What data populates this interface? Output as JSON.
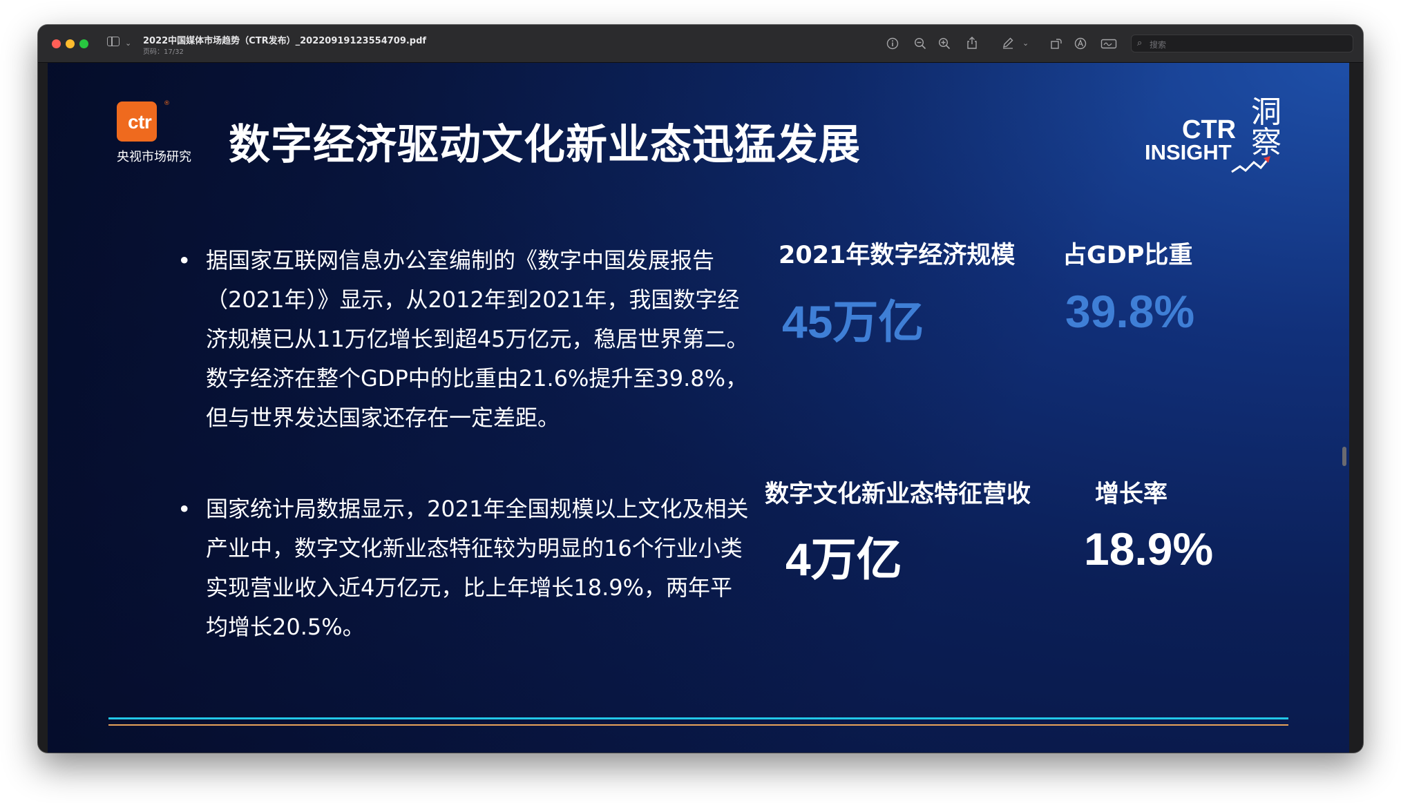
{
  "window": {
    "title": "2022中国媒体市场趋势（CTR发布）_20220919123554709.pdf",
    "page_indicator": "页码：17/32",
    "search_placeholder": "搜索",
    "toolbar_icons": [
      "info-icon",
      "zoom-out-icon",
      "zoom-in-icon",
      "share-icon",
      "markup-pen-icon",
      "chevron-down-icon",
      "rotate-icon",
      "annotate-icon",
      "signature-icon"
    ]
  },
  "slide": {
    "logo": {
      "text": "ctr",
      "registered": "®",
      "subtitle": "央视市场研究",
      "color": "#ef6a1e"
    },
    "title": "数字经济驱动文化新业态迅猛发展",
    "insight_logo": {
      "line1": "CTR",
      "line2": "INSIGHT",
      "chinese": "洞察"
    },
    "bullets": [
      {
        "marker": "•",
        "text": "据国家互联网信息办公室编制的《数字中国发展报告（2021年）》显示，从2012年到2021年，我国数字经济规模已从11万亿增长到超45万亿元，稳居世界第二。数字经济在整个GDP中的比重由21.6%提升至39.8%，但与世界发达国家还存在一定差距。"
      },
      {
        "marker": "•",
        "text": "国家统计局数据显示，2021年全国规模以上文化及相关产业中，数字文化新业态特征较为明显的16个行业小类实现营业收入近4万亿元，比上年增长18.9%，两年平均增长20.5%。"
      }
    ],
    "stats": [
      {
        "label": "2021年数字经济规模",
        "value": "45万亿"
      },
      {
        "label": "占GDP比重",
        "value": "39.8%"
      },
      {
        "label": "数字文化新业态特征营收",
        "value": "4万亿"
      },
      {
        "label": "增长率",
        "value": "18.9%"
      }
    ],
    "colors": {
      "accent_blue": "#3f7fd6",
      "line_cyan": "#22c7e8",
      "line_orange": "#e9a35a"
    }
  }
}
